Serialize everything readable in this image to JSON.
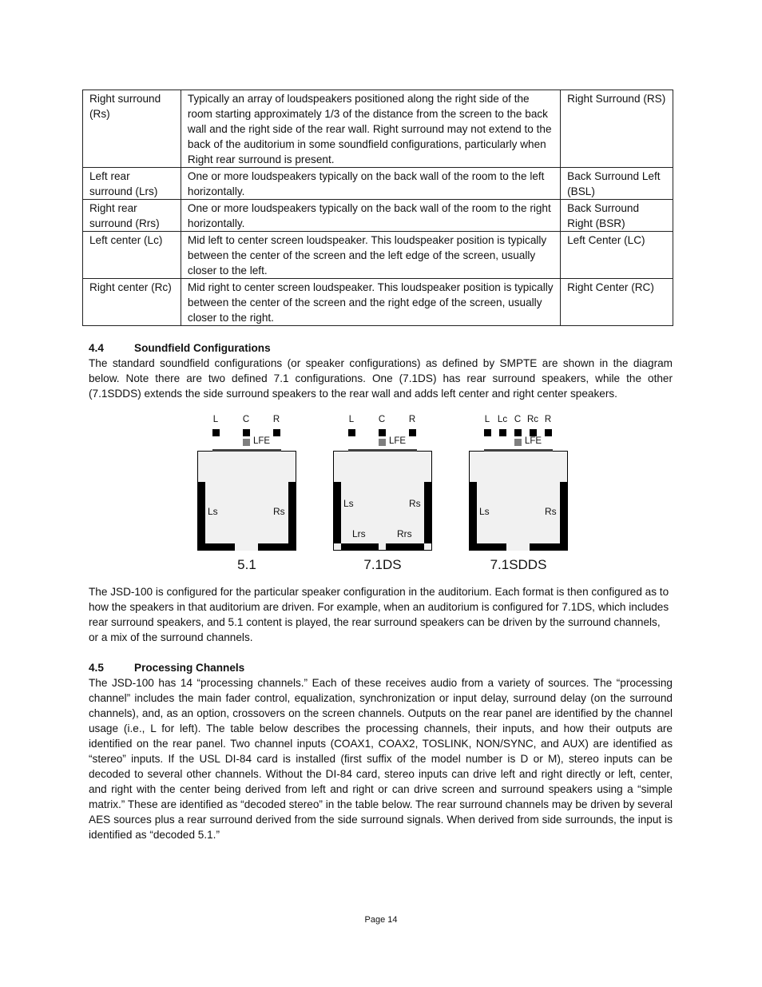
{
  "table": {
    "rows": [
      {
        "name": "Right surround (Rs)",
        "description": "Typically an array of loudspeakers positioned along the right side of the room starting approximately 1/3 of the distance from the screen to the back wall and the right side of the rear wall. Right surround may not extend to the back of the auditorium in some soundfield configurations, particularly when Right rear surround is present.",
        "smpte": "Right Surround (RS)"
      },
      {
        "name": "Left rear surround (Lrs)",
        "description": "One or more loudspeakers typically on the back wall of the room to the left horizontally.",
        "smpte": "Back Surround Left (BSL)"
      },
      {
        "name": "Right rear surround (Rrs)",
        "description": "One or more loudspeakers typically on the back wall of the room to the right horizontally.",
        "smpte": "Back Surround Right (BSR)"
      },
      {
        "name": "Left center (Lc)",
        "description": "Mid left to center screen loudspeaker. This loudspeaker position is typically between the center of the screen and the left edge of the screen, usually closer to the left.",
        "smpte": "Left Center (LC)"
      },
      {
        "name": "Right center (Rc)",
        "description": "Mid right to center screen loudspeaker. This loudspeaker position is typically between the center of the screen and the right edge of the screen, usually closer to the right.",
        "smpte": "Right Center (RC)"
      }
    ]
  },
  "section_4_4": {
    "number": "4.4",
    "title": "Soundfield Configurations",
    "body": "The standard soundfield configurations (or speaker configurations) as defined by SMPTE are shown in the diagram below.  Note there are two defined 7.1 configurations.  One (7.1DS) has rear surround speakers, while the other (7.1SDDS) extends the side surround speakers to the rear wall and adds left center and right center speakers."
  },
  "diagrams": [
    {
      "format": "5.1",
      "front": [
        "L",
        "C",
        "R"
      ],
      "lfe": "LFE",
      "surrounds": [
        "Ls",
        "Rs"
      ],
      "rear": []
    },
    {
      "format": "7.1DS",
      "front": [
        "L",
        "C",
        "R"
      ],
      "lfe": "LFE",
      "surrounds": [
        "Ls",
        "Rs"
      ],
      "rear": [
        "Lrs",
        "Rrs"
      ]
    },
    {
      "format": "7.1SDDS",
      "front": [
        "L",
        "Lc",
        "C",
        "Rc",
        "R"
      ],
      "lfe": "LFE",
      "surrounds": [
        "Ls",
        "Rs"
      ],
      "rear": []
    }
  ],
  "config_paragraph": "The JSD-100 is configured for the particular speaker configuration in the auditorium. Each format is then configured as to how the speakers in that auditorium are driven. For example, when an auditorium is configured for 7.1DS, which includes rear surround speakers, and 5.1 content is played, the rear surround speakers can be driven by the surround channels, or a mix of the surround channels.",
  "section_4_5": {
    "number": "4.5",
    "title": "Processing Channels",
    "body": "The JSD-100 has 14 “processing channels.”  Each of these receives audio from a variety of sources.  The “processing channel” includes the main fader control, equalization, synchronization or input delay, surround delay (on the surround channels), and, as an option, crossovers on the screen channels.  Outputs on the rear panel are identified by the channel usage (i.e., L for left).  The table below describes the processing channels, their inputs, and how their outputs are identified on the rear panel.  Two channel inputs (COAX1, COAX2, TOSLINK, NON/SYNC, and AUX) are identified as “stereo” inputs.  If the USL DI-84 card is installed (first suffix of the model number is D or M), stereo inputs can be decoded to several other channels.  Without the DI-84 card, stereo inputs can drive left and right directly or left, center, and right with the center being derived from left and right or can drive screen and surround speakers using a “simple matrix.” These are identified as “decoded stereo” in the table below. The rear surround channels may be driven by several AES sources plus a rear surround derived from the side surround signals. When derived from side surrounds, the input is identified as “decoded 5.1.”"
  },
  "footer": {
    "page": "Page 14"
  }
}
